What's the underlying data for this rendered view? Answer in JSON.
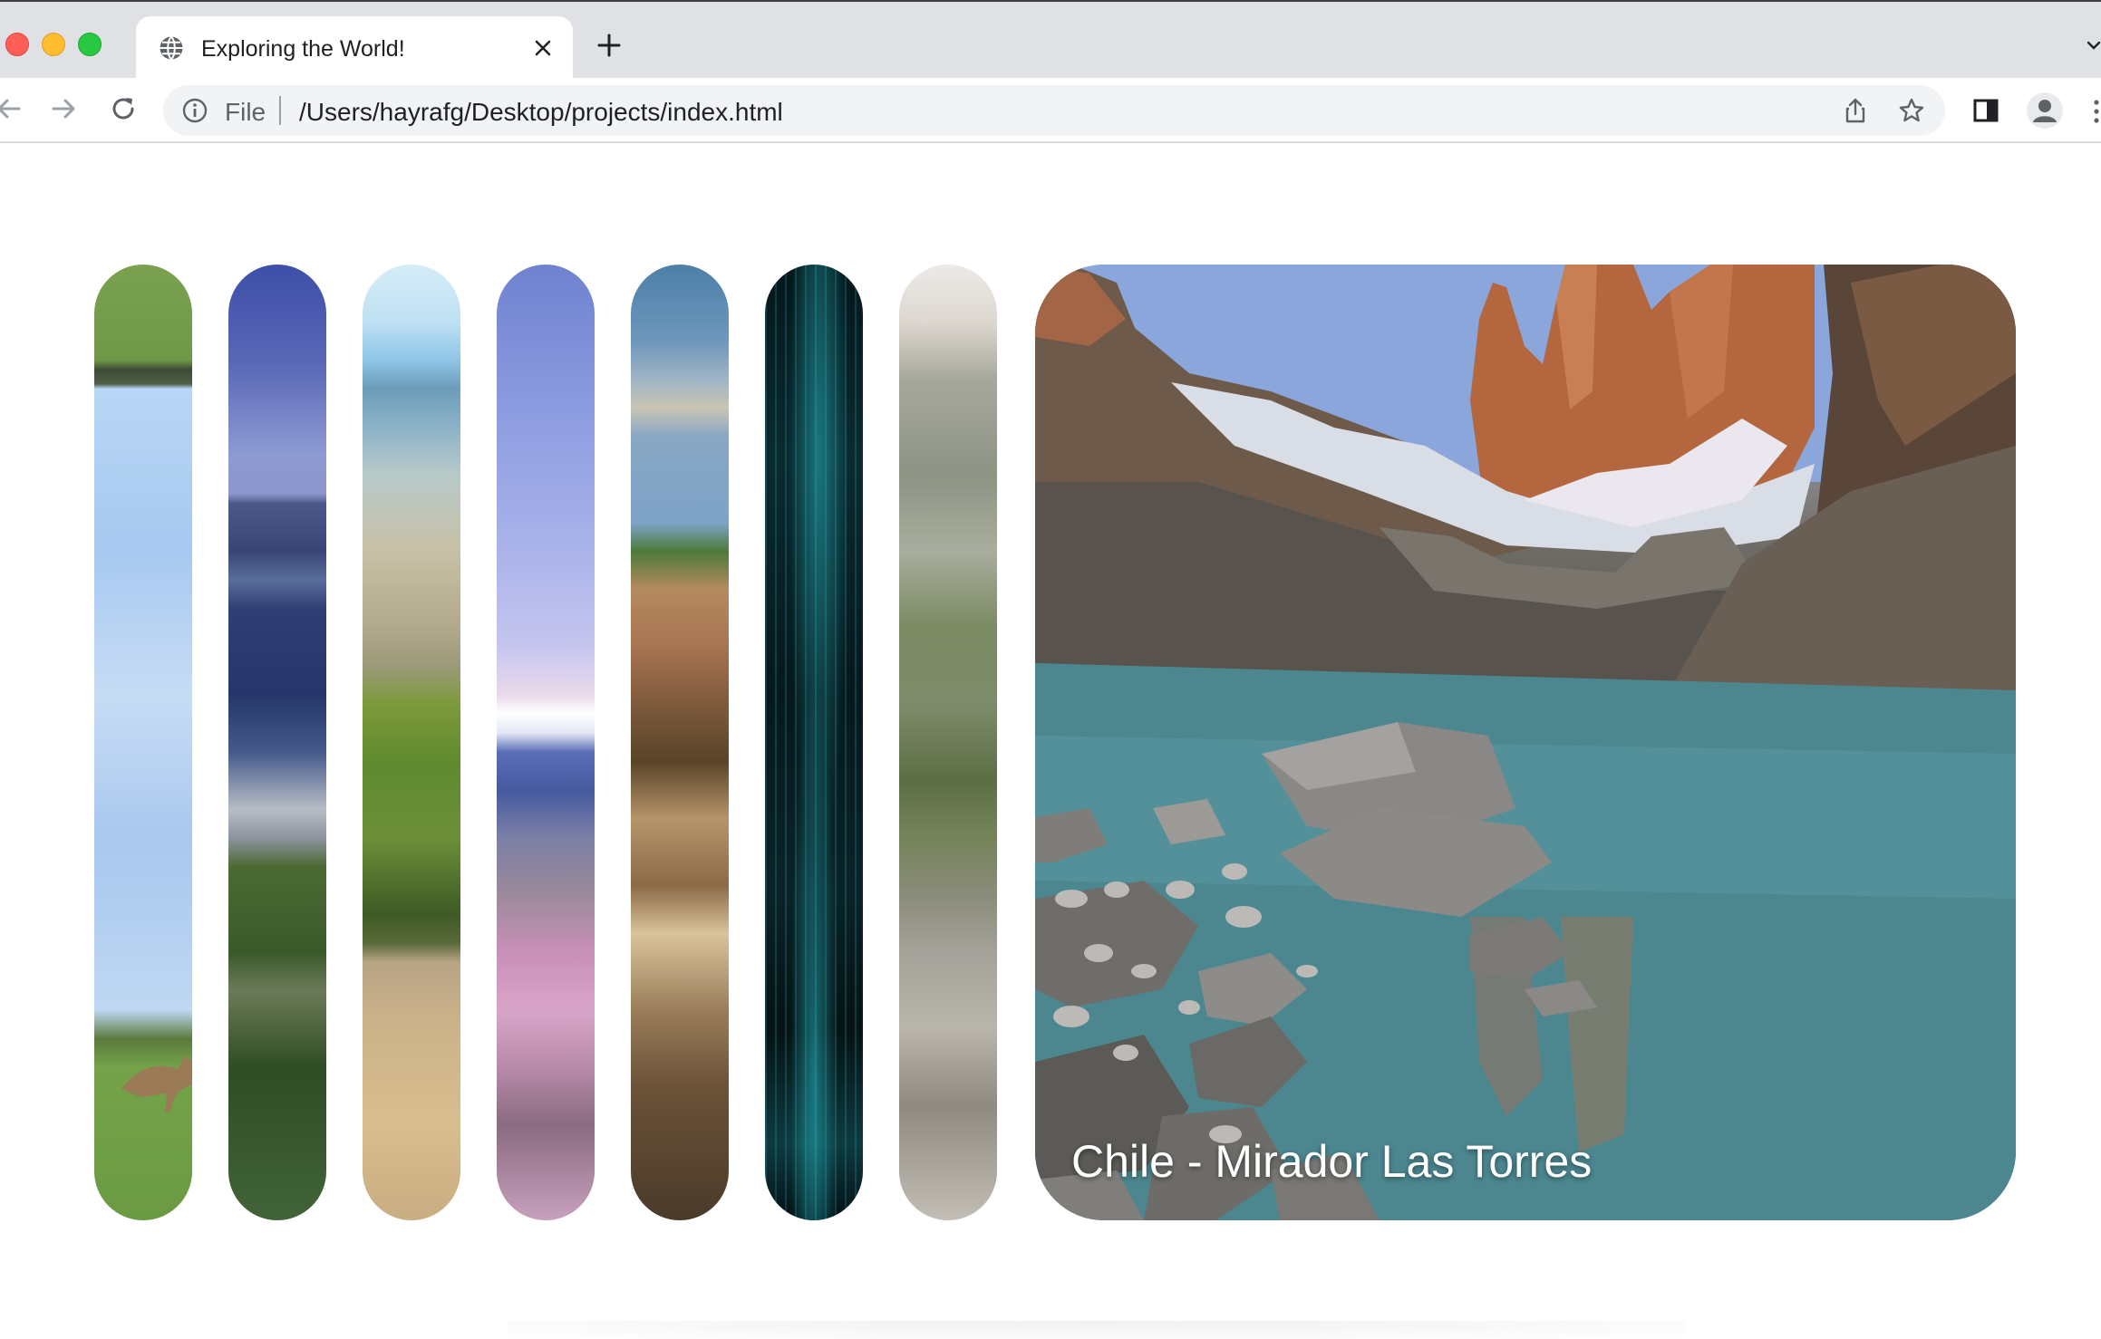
{
  "browser": {
    "tab": {
      "title": "Exploring the World!",
      "icon": "globe-icon"
    },
    "omnibox": {
      "scheme_label": "File",
      "url": "/Users/hayrafg/Desktop/projects/index.html"
    },
    "icons": {
      "back": "arrow-left-icon",
      "forward": "arrow-right-icon",
      "reload": "reload-icon",
      "info": "info-icon",
      "share": "share-icon",
      "bookmark": "star-icon",
      "side_panel": "side-panel-icon",
      "profile": "profile-avatar-icon",
      "new_tab": "plus-icon",
      "close_tab": "close-icon"
    }
  },
  "page": {
    "panels": [
      {
        "id": "kangaroo-field",
        "active": false,
        "title": ""
      },
      {
        "id": "coastal-city",
        "active": false,
        "title": ""
      },
      {
        "id": "cactus-mountains",
        "active": false,
        "title": ""
      },
      {
        "id": "mount-fuji",
        "active": false,
        "title": ""
      },
      {
        "id": "village-street",
        "active": false,
        "title": ""
      },
      {
        "id": "glowworm-cave",
        "active": false,
        "title": ""
      },
      {
        "id": "mountain-stairs",
        "active": false,
        "title": ""
      },
      {
        "id": "mirador-las-torres",
        "active": true,
        "title": "Chile - Mirador Las Torres"
      }
    ]
  },
  "colors": {
    "tabstrip_bg": "#dfe1e5",
    "omnibox_bg": "#f1f3f4",
    "title_text": "#ffffff"
  }
}
